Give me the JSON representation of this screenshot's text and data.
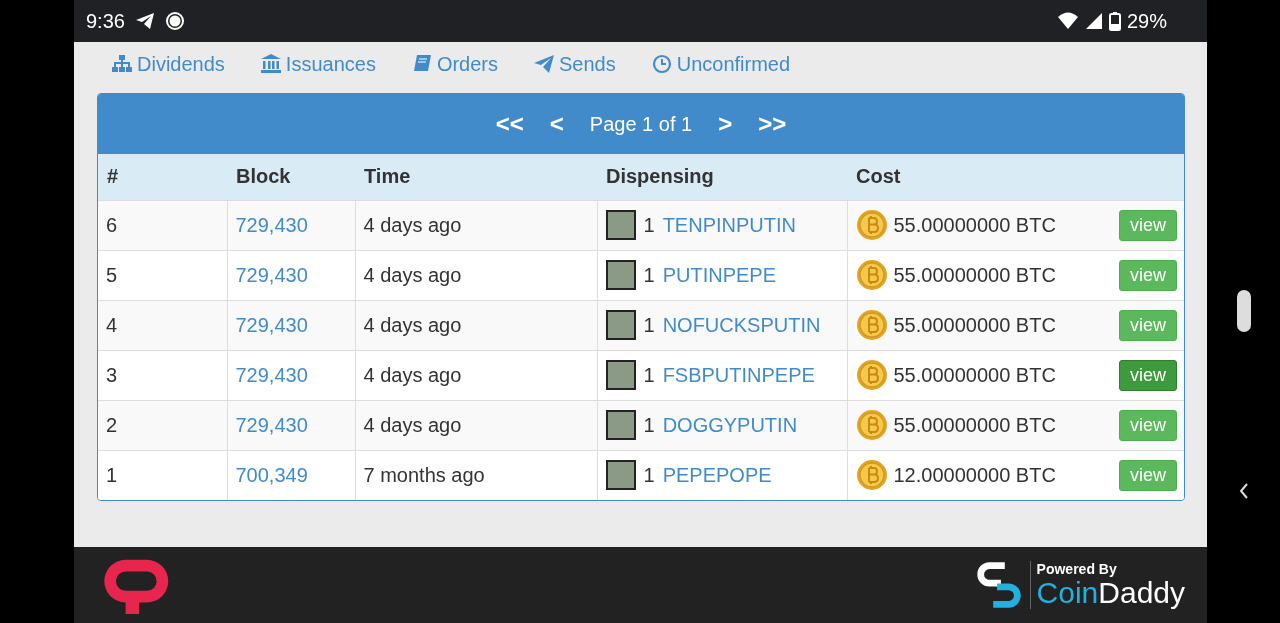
{
  "status_bar": {
    "time": "9:36",
    "battery": "29%"
  },
  "nav": [
    {
      "label": "Dividends",
      "kind": "sitemap"
    },
    {
      "label": "Issuances",
      "kind": "bank"
    },
    {
      "label": "Orders",
      "kind": "book"
    },
    {
      "label": "Sends",
      "kind": "plane"
    },
    {
      "label": "Unconfirmed",
      "kind": "clock"
    }
  ],
  "pager": {
    "first": "<<",
    "prev": "<",
    "label": "Page 1 of 1",
    "next": ">",
    "last": ">>"
  },
  "table": {
    "columns": [
      "#",
      "Block",
      "Time",
      "Dispensing",
      "Cost"
    ],
    "rows": [
      {
        "num": "6",
        "block": "729,430",
        "time": "4 days ago",
        "qty": "1",
        "asset": "TENPINPUTIN",
        "cost": "55.00000000 BTC",
        "action": "view",
        "hovered": false
      },
      {
        "num": "5",
        "block": "729,430",
        "time": "4 days ago",
        "qty": "1",
        "asset": "PUTINPEPE",
        "cost": "55.00000000 BTC",
        "action": "view",
        "hovered": false
      },
      {
        "num": "4",
        "block": "729,430",
        "time": "4 days ago",
        "qty": "1",
        "asset": "NOFUCKSPUTIN",
        "cost": "55.00000000 BTC",
        "action": "view",
        "hovered": false
      },
      {
        "num": "3",
        "block": "729,430",
        "time": "4 days ago",
        "qty": "1",
        "asset": "FSBPUTINPEPE",
        "cost": "55.00000000 BTC",
        "action": "view",
        "hovered": true
      },
      {
        "num": "2",
        "block": "729,430",
        "time": "4 days ago",
        "qty": "1",
        "asset": "DOGGYPUTIN",
        "cost": "55.00000000 BTC",
        "action": "view",
        "hovered": false
      },
      {
        "num": "1",
        "block": "700,349",
        "time": "7 months ago",
        "qty": "1",
        "asset": "PEPEPOPE",
        "cost": "12.00000000 BTC",
        "action": "view",
        "hovered": false
      }
    ]
  },
  "footer": {
    "powered_by": "Powered By",
    "brand_a": "Coin",
    "brand_b": "Daddy"
  }
}
